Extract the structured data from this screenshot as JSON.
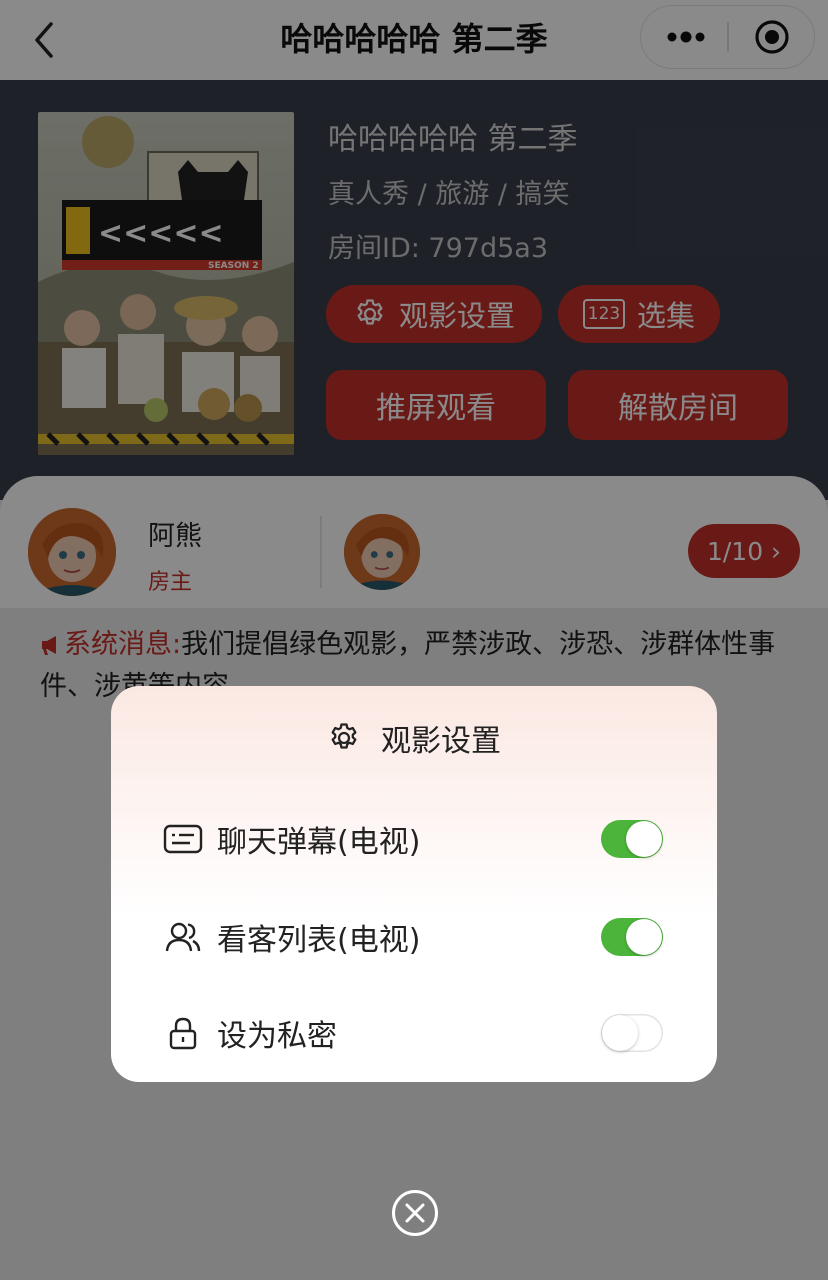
{
  "nav": {
    "title": "哈哈哈哈哈 第二季",
    "back_icon": "chevron-left-icon",
    "more_icon": "more-dots-icon",
    "close_icon": "target-circle-icon"
  },
  "room": {
    "title": "哈哈哈哈哈 第二季",
    "tags": "真人秀 / 旅游 / 搞笑",
    "room_id": "房间ID: 797d5a3",
    "settings_button": "观影设置",
    "episodes_button": "选集",
    "episodes_icon_text": "123",
    "cast_button": "推屏观看",
    "dissolve_button": "解散房间",
    "poster_season_text": "SEASON 2"
  },
  "members": {
    "host_name": "阿熊",
    "host_role": "房主",
    "count": "1/10 ›"
  },
  "system_message": {
    "label": "系统消息:",
    "text": "我们提倡绿色观影，严禁涉政、涉恐、涉群体性事件、涉黄等内容"
  },
  "modal": {
    "title": "观影设置",
    "rows": [
      {
        "label": "聊天弹幕(电视)",
        "icon": "chat-barrage-icon",
        "enabled": true
      },
      {
        "label": "看客列表(电视)",
        "icon": "users-icon",
        "enabled": true
      },
      {
        "label": "设为私密",
        "icon": "lock-icon",
        "enabled": false
      }
    ]
  },
  "colors": {
    "accent": "#c4302a",
    "header_bg": "#393e4a",
    "toggle_on": "#4cb43a"
  }
}
